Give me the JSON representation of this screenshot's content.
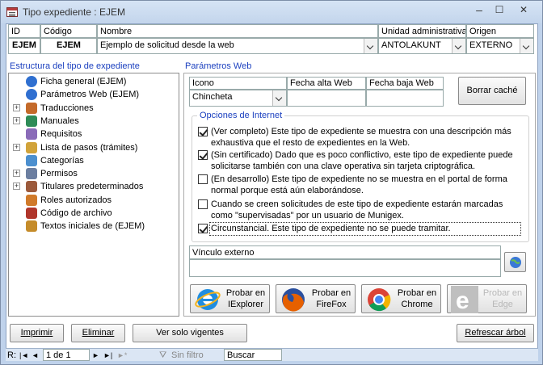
{
  "window": {
    "title": "Tipo expediente : EJEM",
    "minimize": "–",
    "maximize": "☐",
    "close": "✕"
  },
  "header_grid": {
    "columns": [
      "ID",
      "Código",
      "Nombre",
      "Unidad administrativa",
      "Origen"
    ],
    "row": {
      "id": "EJEM",
      "codigo": "EJEM",
      "nombre": "Ejemplo de solicitud desde la web",
      "unidad": "ANTOLAKUNT",
      "origen": "EXTERNO"
    }
  },
  "tree": {
    "title": "Estructura del tipo de expediente",
    "items": [
      {
        "label": "Ficha general (EJEM)",
        "icon": "globe-icon",
        "expandable": false
      },
      {
        "label": "Parámetros Web (EJEM)",
        "icon": "globe-icon",
        "expandable": false
      },
      {
        "label": "Traducciones",
        "icon": "people-icon",
        "expandable": true
      },
      {
        "label": "Manuales",
        "icon": "book-icon",
        "expandable": true
      },
      {
        "label": "Requisitos",
        "icon": "checklist-icon",
        "expandable": false
      },
      {
        "label": "Lista de pasos (trámites)",
        "icon": "steps-icon",
        "expandable": true
      },
      {
        "label": "Categorías",
        "icon": "category-icon",
        "expandable": false
      },
      {
        "label": "Permisos",
        "icon": "users-icon",
        "expandable": true
      },
      {
        "label": "Titulares predeterminados",
        "icon": "holders-icon",
        "expandable": true
      },
      {
        "label": "Roles autorizados",
        "icon": "roles-icon",
        "expandable": false
      },
      {
        "label": "Código de archivo",
        "icon": "archive-icon",
        "expandable": false
      },
      {
        "label": "Textos iniciales de (EJEM)",
        "icon": "texts-icon",
        "expandable": false
      }
    ]
  },
  "params": {
    "title": "Parámetros Web",
    "columns": [
      "Icono",
      "Fecha alta Web",
      "Fecha baja Web"
    ],
    "icono_value": "Chincheta",
    "fecha_alta": "",
    "fecha_baja": "",
    "clear_cache_label": "Borrar caché",
    "options_title": "Opciones de Internet",
    "options": [
      {
        "checked": true,
        "text": "(Ver completo) Este tipo de expediente se muestra con una descripción más exhaustiva que el resto de expedientes en la Web."
      },
      {
        "checked": true,
        "text": "(Sin certificado) Dado que es poco conflictivo, este tipo de expediente puede solicitarse también con una clave operativa sin tarjeta criptográfica."
      },
      {
        "checked": false,
        "text": "(En desarrollo) Este tipo de expediente no se muestra en el portal de forma normal porque está aún elaborándose."
      },
      {
        "checked": false,
        "text": "Cuando se creen solicitudes de este tipo de expediente estarán marcadas como \"supervisadas\" por un usuario de Munigex."
      },
      {
        "checked": true,
        "text": "Circunstancial. Este tipo de expediente no se puede tramitar."
      }
    ],
    "external_link_label": "Vínculo externo",
    "external_link_value": "",
    "browsers": [
      {
        "label": "Probar en IExplorer",
        "icon": "ie-icon",
        "enabled": true
      },
      {
        "label": "Probar en FireFox",
        "icon": "firefox-icon",
        "enabled": true
      },
      {
        "label": "Probar en Chrome",
        "icon": "chrome-icon",
        "enabled": true
      },
      {
        "label": "Probar en Edge",
        "icon": "edge-icon",
        "enabled": false
      }
    ]
  },
  "footer": {
    "print": "Imprimir",
    "delete": "Eliminar",
    "show_active": "Ver solo vigentes",
    "refresh_tree": "Refrescar árbol"
  },
  "statusbar": {
    "record_label": "R:",
    "record_value": "1 de 1",
    "filter_label": "Sin filtro",
    "search_label": "Buscar"
  }
}
